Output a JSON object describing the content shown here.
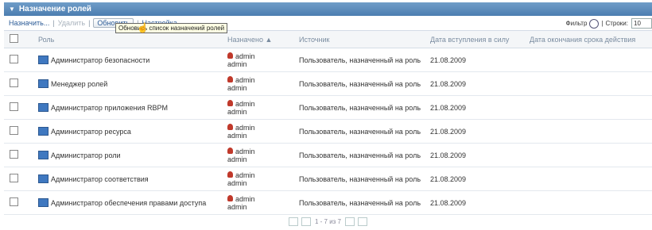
{
  "title": "Назначение ролей",
  "toolbar": {
    "assign": "Назначить...",
    "delete": "Удалить",
    "refresh": "Обновить",
    "settings": "Настройка...",
    "filter": "Фильтр",
    "rows_label": "Строки:",
    "rows_value": "10"
  },
  "tooltip": "Обновить список назначений ролей",
  "columns": {
    "role": "Роль",
    "user": "Назначено",
    "source": "Источник",
    "start": "Дата вступления в силу",
    "end": "Дата окончания срока действия"
  },
  "rows": [
    {
      "role": "Администратор безопасности",
      "user1": "admin",
      "user2": "admin",
      "source": "Пользователь, назначенный на роль",
      "date": "21.08.2009"
    },
    {
      "role": "Менеджер ролей",
      "user1": "admin",
      "user2": "admin",
      "source": "Пользователь, назначенный на роль",
      "date": "21.08.2009"
    },
    {
      "role": "Администратор приложения RBPM",
      "user1": "admin",
      "user2": "admin",
      "source": "Пользователь, назначенный на роль",
      "date": "21.08.2009"
    },
    {
      "role": "Администратор ресурса",
      "user1": "admin",
      "user2": "admin",
      "source": "Пользователь, назначенный на роль",
      "date": "21.08.2009"
    },
    {
      "role": "Администратор роли",
      "user1": "admin",
      "user2": "admin",
      "source": "Пользователь, назначенный на роль",
      "date": "21.08.2009"
    },
    {
      "role": "Администратор соответствия",
      "user1": "admin",
      "user2": "admin",
      "source": "Пользователь, назначенный на роль",
      "date": "21.08.2009"
    },
    {
      "role": "Администратор обеспечения правами доступа",
      "user1": "admin",
      "user2": "admin",
      "source": "Пользователь, назначенный на роль",
      "date": "21.08.2009"
    }
  ],
  "pagination": "1 - 7 из 7"
}
